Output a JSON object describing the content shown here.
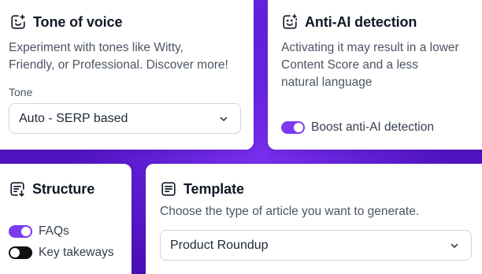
{
  "colors": {
    "accent": "#7c3aed",
    "background": "#5a1ed0",
    "toggle_off": "#111111"
  },
  "tone_card": {
    "title": "Tone of voice",
    "icon": "smile-sparkle-icon",
    "description_line1": "Experiment with tones like Witty,",
    "description_line2": "Friendly, or Professional. Discover more!",
    "tone_label": "Tone",
    "tone_select_value": "Auto - SERP based"
  },
  "anti_ai_card": {
    "title": "Anti-AI detection",
    "icon": "smile-sparkle-icon",
    "description_line1": "Activating it may result in a lower",
    "description_line2": "Content Score and a less",
    "description_line3": "natural language",
    "toggle_label": "Boost anti-AI detection",
    "toggle_on": true
  },
  "structure_card": {
    "title": "Structure",
    "icon": "list-down-arrow-icon",
    "toggles": [
      {
        "label": "FAQs",
        "on": true
      },
      {
        "label": "Key takeways",
        "on": false
      }
    ]
  },
  "template_card": {
    "title": "Template",
    "icon": "list-box-icon",
    "description": "Choose the type of article you want to generate.",
    "template_select_value": "Product Roundup"
  }
}
